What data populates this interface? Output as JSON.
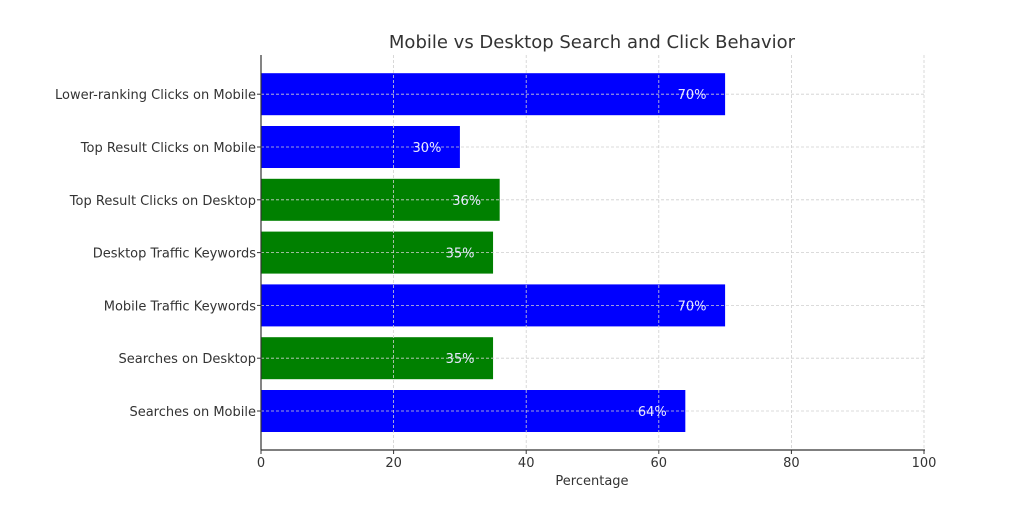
{
  "chart_data": {
    "type": "bar",
    "orientation": "horizontal",
    "title": "Mobile vs Desktop Search and Click Behavior",
    "xlabel": "Percentage",
    "ylabel": "",
    "xlim": [
      0,
      100
    ],
    "xticks": [
      0,
      20,
      40,
      60,
      80,
      100
    ],
    "grid": true,
    "categories": [
      "Searches on Mobile",
      "Searches on Desktop",
      "Mobile Traffic Keywords",
      "Desktop Traffic Keywords",
      "Top Result Clicks on Desktop",
      "Top Result Clicks on Mobile",
      "Lower-ranking Clicks on Mobile"
    ],
    "values": [
      64,
      35,
      70,
      35,
      36,
      30,
      70
    ],
    "value_labels": [
      "64%",
      "35%",
      "70%",
      "35%",
      "36%",
      "30%",
      "70%"
    ],
    "bar_colors": [
      "#0000ff",
      "#008000",
      "#0000ff",
      "#008000",
      "#008000",
      "#0000ff",
      "#0000ff"
    ],
    "series_colors": {
      "mobile": "#0000ff",
      "desktop": "#008000"
    }
  }
}
